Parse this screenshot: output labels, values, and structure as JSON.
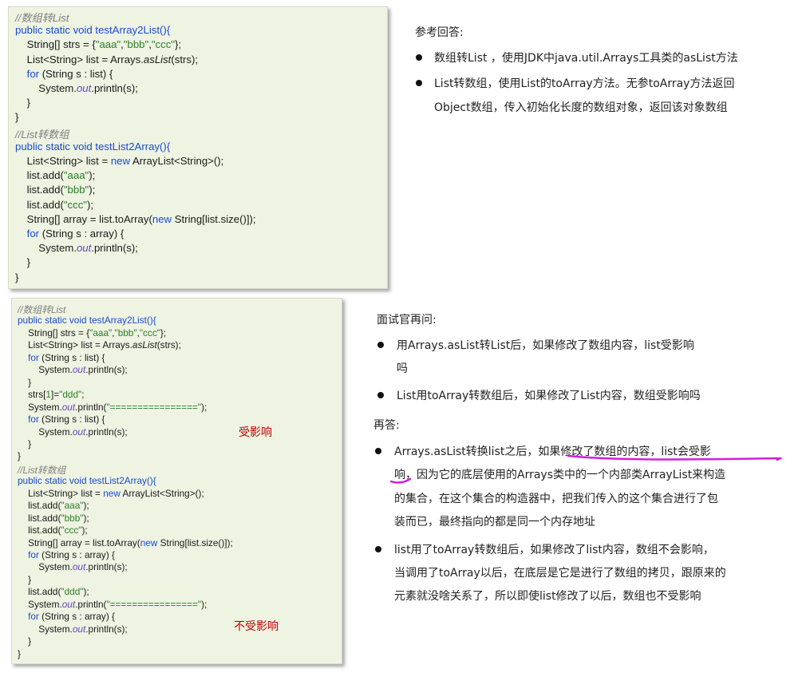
{
  "box1": {
    "lines": [
      [
        {
          "t": "//数组转List",
          "c": "cm"
        }
      ],
      [
        {
          "t": "public static void testArray2List(){",
          "c": "kw"
        }
      ],
      [
        {
          "t": "    String[] strs = {"
        },
        {
          "t": "\"aaa\"",
          "c": "st"
        },
        {
          "t": ","
        },
        {
          "t": "\"bbb\"",
          "c": "st"
        },
        {
          "t": ","
        },
        {
          "t": "\"ccc\"",
          "c": "st"
        },
        {
          "t": "};"
        }
      ],
      [
        {
          "t": "    List<String> list = Arrays."
        },
        {
          "t": "asList",
          "c": "it"
        },
        {
          "t": "(strs);"
        }
      ],
      [
        {
          "t": "    "
        },
        {
          "t": "for",
          "c": "kw"
        },
        {
          "t": " (String s : list) {"
        }
      ],
      [
        {
          "t": "        System."
        },
        {
          "t": "out",
          "c": "fd"
        },
        {
          "t": ".println(s);"
        }
      ],
      [
        {
          "t": "    }"
        }
      ],
      [
        {
          "t": "}"
        }
      ],
      [
        {
          "t": "//List转数组",
          "c": "cm"
        }
      ],
      [
        {
          "t": "public static void testList2Array(){",
          "c": "kw"
        }
      ],
      [
        {
          "t": "    List<String> list = "
        },
        {
          "t": "new",
          "c": "kw"
        },
        {
          "t": " ArrayList<String>();"
        }
      ],
      [
        {
          "t": "    list.add("
        },
        {
          "t": "\"aaa\"",
          "c": "st"
        },
        {
          "t": ");"
        }
      ],
      [
        {
          "t": "    list.add("
        },
        {
          "t": "\"bbb\"",
          "c": "st"
        },
        {
          "t": ");"
        }
      ],
      [
        {
          "t": "    list.add("
        },
        {
          "t": "\"ccc\"",
          "c": "st"
        },
        {
          "t": ");"
        }
      ],
      [
        {
          "t": "    String[] array = list.toArray("
        },
        {
          "t": "new",
          "c": "kw"
        },
        {
          "t": " String[list.size()]);"
        }
      ],
      [
        {
          "t": "    "
        },
        {
          "t": "for",
          "c": "kw"
        },
        {
          "t": " (String s : array) {"
        }
      ],
      [
        {
          "t": "        System."
        },
        {
          "t": "out",
          "c": "fd"
        },
        {
          "t": ".println(s);"
        }
      ],
      [
        {
          "t": "    }"
        }
      ],
      [
        {
          "t": "}"
        }
      ]
    ]
  },
  "box2": {
    "lines": [
      [
        {
          "t": "//数组转List",
          "c": "cm"
        }
      ],
      [
        {
          "t": "public static void testArray2List(){",
          "c": "kw"
        }
      ],
      [
        {
          "t": "    String[] strs = {"
        },
        {
          "t": "\"aaa\"",
          "c": "st"
        },
        {
          "t": ","
        },
        {
          "t": "\"bbb\"",
          "c": "st"
        },
        {
          "t": ","
        },
        {
          "t": "\"ccc\"",
          "c": "st"
        },
        {
          "t": "};"
        }
      ],
      [
        {
          "t": "    List<String> list = Arrays."
        },
        {
          "t": "asList",
          "c": "it"
        },
        {
          "t": "(strs);"
        }
      ],
      [
        {
          "t": "    "
        },
        {
          "t": "for",
          "c": "kw"
        },
        {
          "t": " (String s : list) {"
        }
      ],
      [
        {
          "t": "        System."
        },
        {
          "t": "out",
          "c": "fd"
        },
        {
          "t": ".println(s);"
        }
      ],
      [
        {
          "t": "    }"
        }
      ],
      [
        {
          "t": "    strs["
        },
        {
          "t": "1",
          "c": "nm"
        },
        {
          "t": "]="
        },
        {
          "t": "\"ddd\"",
          "c": "st"
        },
        {
          "t": ";"
        }
      ],
      [
        {
          "t": "    System."
        },
        {
          "t": "out",
          "c": "fd"
        },
        {
          "t": ".println("
        },
        {
          "t": "\"================\"",
          "c": "st"
        },
        {
          "t": ");"
        }
      ],
      [
        {
          "t": "    "
        },
        {
          "t": "for",
          "c": "kw"
        },
        {
          "t": " (String s : list) {"
        }
      ],
      [
        {
          "t": "        System."
        },
        {
          "t": "out",
          "c": "fd"
        },
        {
          "t": ".println(s);"
        }
      ],
      [
        {
          "t": "    }"
        }
      ],
      [
        {
          "t": "}"
        }
      ],
      [
        {
          "t": "//List转数组",
          "c": "cm"
        }
      ],
      [
        {
          "t": "public static void testList2Array(){",
          "c": "kw"
        }
      ],
      [
        {
          "t": "    List<String> list = "
        },
        {
          "t": "new",
          "c": "kw"
        },
        {
          "t": " ArrayList<String>();"
        }
      ],
      [
        {
          "t": "    list.add("
        },
        {
          "t": "\"aaa\"",
          "c": "st"
        },
        {
          "t": ");"
        }
      ],
      [
        {
          "t": "    list.add("
        },
        {
          "t": "\"bbb\"",
          "c": "st"
        },
        {
          "t": ");"
        }
      ],
      [
        {
          "t": "    list.add("
        },
        {
          "t": "\"ccc\"",
          "c": "st"
        },
        {
          "t": ");"
        }
      ],
      [
        {
          "t": "    String[] array = list.toArray("
        },
        {
          "t": "new",
          "c": "kw"
        },
        {
          "t": " String[list.size()]);"
        }
      ],
      [
        {
          "t": "    "
        },
        {
          "t": "for",
          "c": "kw"
        },
        {
          "t": " (String s : array) {"
        }
      ],
      [
        {
          "t": "        System."
        },
        {
          "t": "out",
          "c": "fd"
        },
        {
          "t": ".println(s);"
        }
      ],
      [
        {
          "t": "    }"
        }
      ],
      [
        {
          "t": "    list.add("
        },
        {
          "t": "\"ddd\"",
          "c": "st"
        },
        {
          "t": ");"
        }
      ],
      [
        {
          "t": "    System."
        },
        {
          "t": "out",
          "c": "fd"
        },
        {
          "t": ".println("
        },
        {
          "t": "\"================\"",
          "c": "st"
        },
        {
          "t": ");"
        }
      ],
      [
        {
          "t": "    "
        },
        {
          "t": "for",
          "c": "kw"
        },
        {
          "t": " (String s : array) {"
        }
      ],
      [
        {
          "t": "        System."
        },
        {
          "t": "out",
          "c": "fd"
        },
        {
          "t": ".println(s);"
        }
      ],
      [
        {
          "t": "    }"
        }
      ],
      [
        {
          "t": "}"
        }
      ]
    ],
    "note_affected": "受影响",
    "note_not_affected": "不受影响"
  },
  "answer1": {
    "heading": "参考回答:",
    "b1": "数组转List ，使用JDK中java.util.Arrays工具类的asList方法",
    "b2_l1": "List转数组，使用List的toArray方法。无参toArray方法返回",
    "b2_l2": "Object数组，传入初始化长度的数组对象，返回该对象数组"
  },
  "answer2": {
    "heading": "面试官再问:",
    "q1_l1": "用Arrays.asList转List后，如果修改了数组内容，list受影响",
    "q1_l2": "吗",
    "q2": "List用toArray转数组后，如果修改了List内容，数组受影响吗",
    "heading2": "再答:",
    "a1_pre": "Arrays.asList转换list之后，",
    "a1_ul": "如果修改了数组的内容，list会受影",
    "a1_l2_ul": "响",
    "a1_l2_rest": "，因为它的底层使用的Arrays类中的一个内部类ArrayList来构造",
    "a1_l3": "的集合，在这个集合的构造器中，把我们传入的这个集合进行了包",
    "a1_l4": "装而已，最终指向的都是同一个内存地址",
    "a2_l1": "list用了toArray转数组后，如果修改了list内容，数组不会影响，",
    "a2_l2": "当调用了toArray以后，在底层是它是进行了数组的拷贝，跟原来的",
    "a2_l3": "元素就没啥关系了，所以即使list修改了以后，数组也不受影响"
  }
}
